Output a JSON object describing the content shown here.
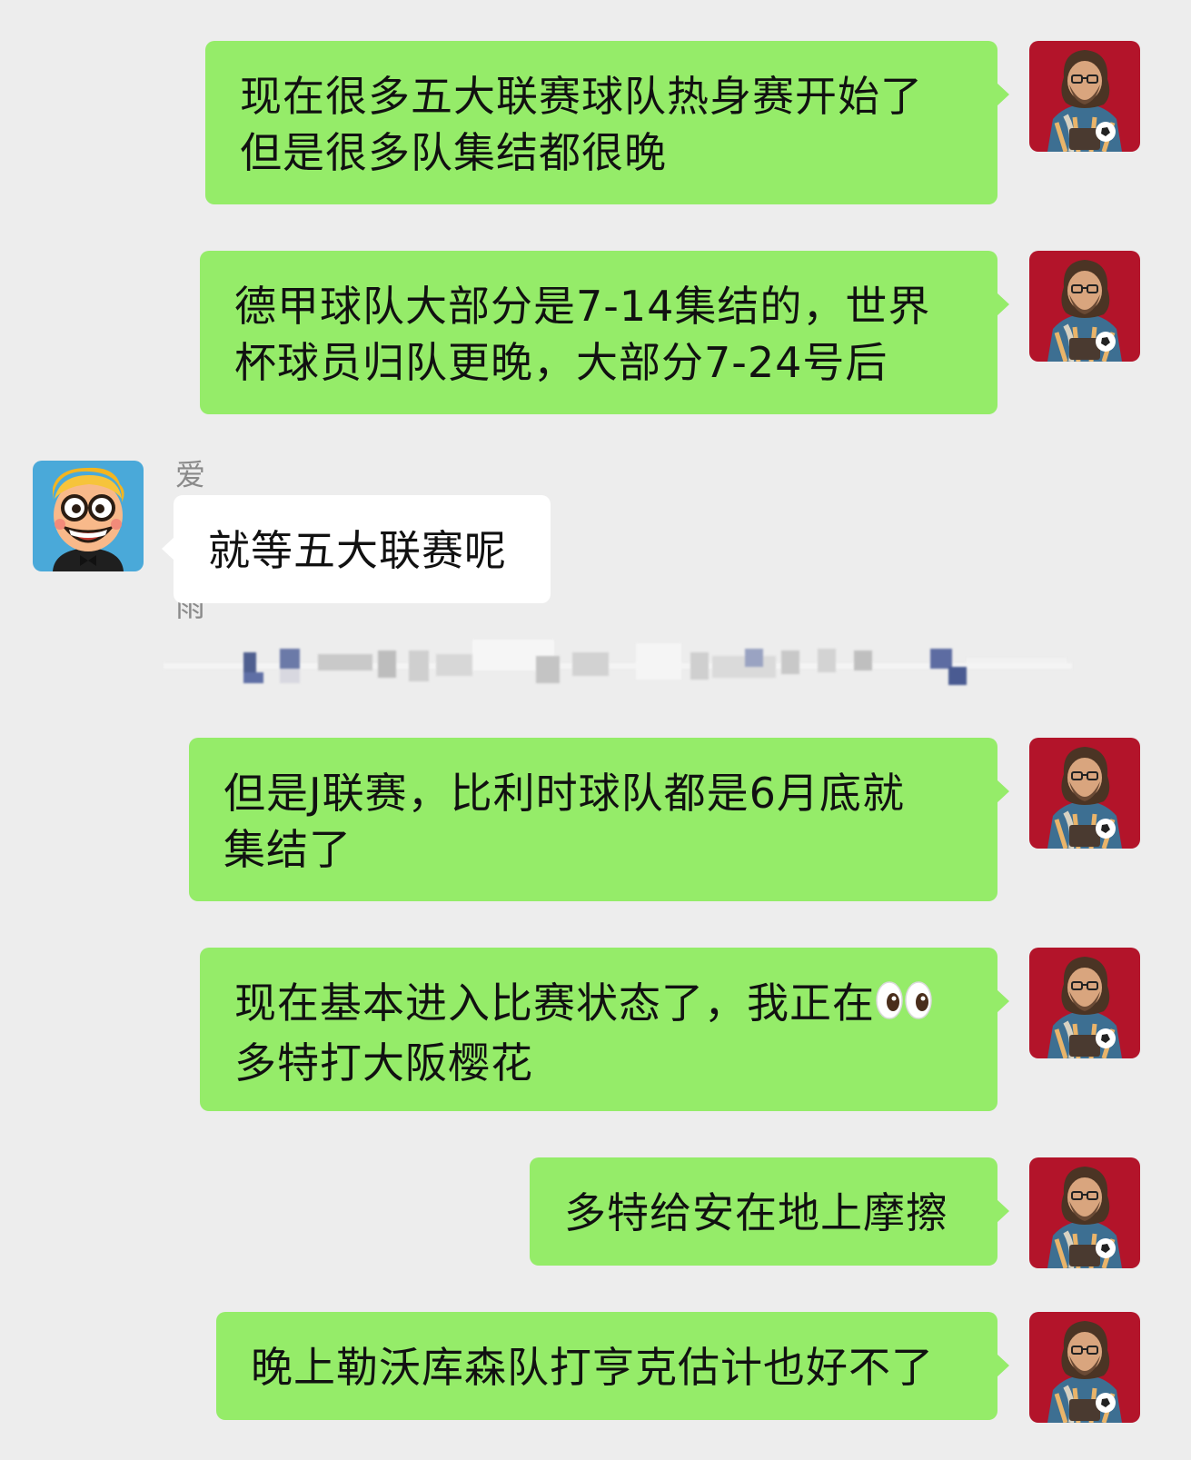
{
  "messages": [
    {
      "side": "out",
      "text": "现在很多五大联赛球队热身赛开始了\n但是很多队集结都很晚"
    },
    {
      "side": "out",
      "text": "德甲球队大部分是7-14集结的，世界\n杯球员归队更晚，大部分7-24号后"
    },
    {
      "side": "in",
      "sender": "爱毛毛雨",
      "text": "就等五大联赛呢"
    },
    {
      "side": "out",
      "text": "但是J联赛，比利时球队都是6月底就\n集结了"
    },
    {
      "side": "out",
      "text_before": "现在基本进入比赛状态了，我正在",
      "emoji": "eyes",
      "text_after": "\n多特打大阪樱花"
    },
    {
      "side": "out",
      "text": "多特给安在地上摩擦"
    },
    {
      "side": "out",
      "text": "晚上勒沃库森队打亨克估计也好不了"
    }
  ],
  "colors": {
    "background": "#ededed",
    "outgoing_bubble": "#95ec69",
    "incoming_bubble": "#ffffff",
    "name_text": "#8a8a8a",
    "self_avatar_bg": "#b3142a",
    "other_avatar_bg": "#4aa9d9"
  },
  "icons": {
    "self_avatar": "man-with-football-avatar",
    "other_avatar": "cartoon-boy-avatar",
    "eyes_emoji": "eyes-emoji"
  }
}
